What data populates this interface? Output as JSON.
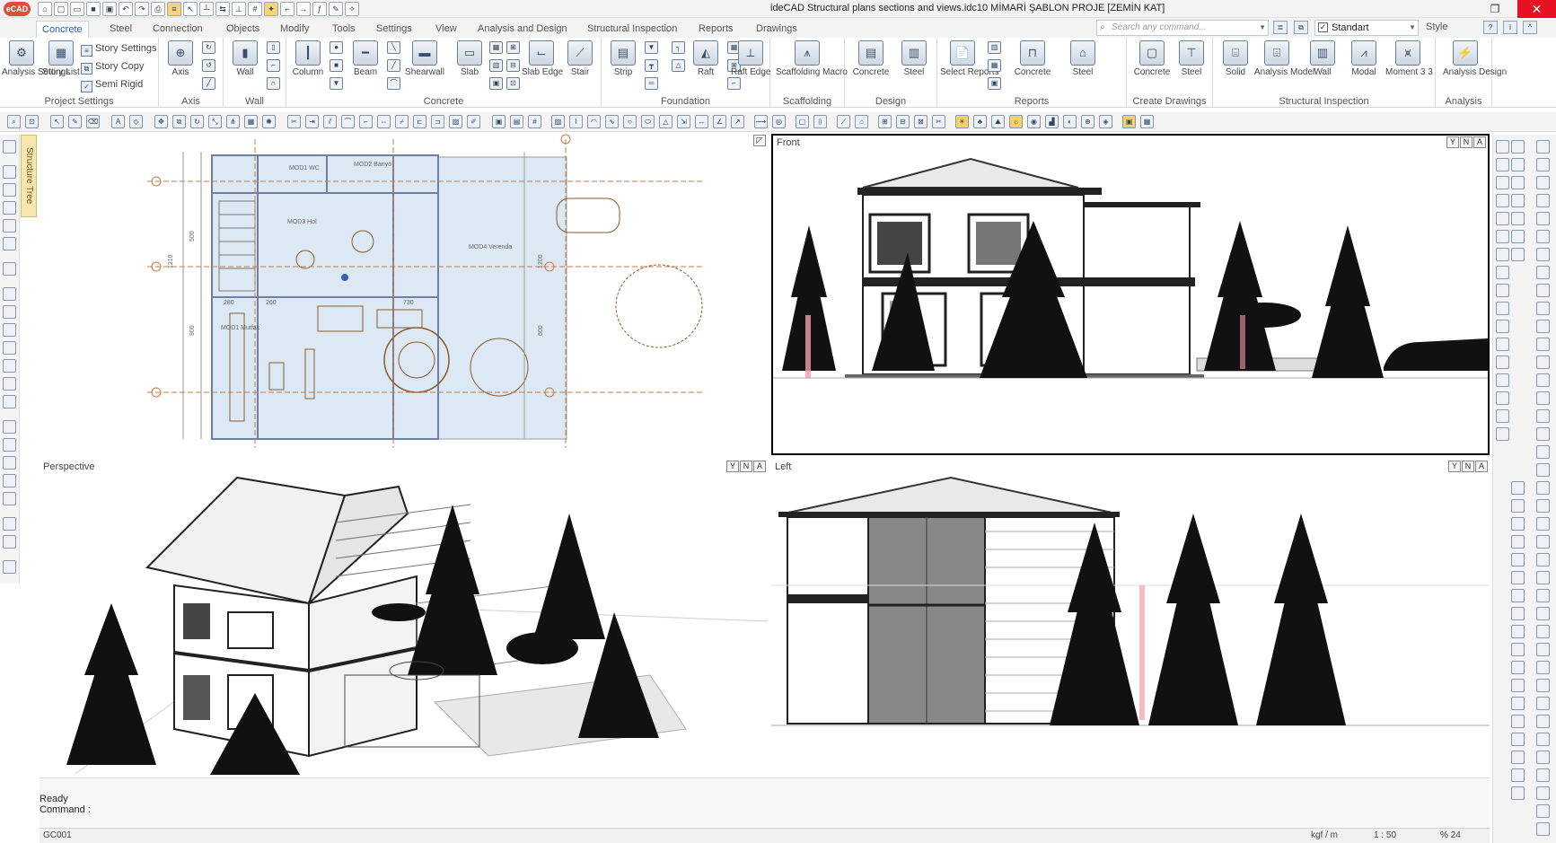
{
  "app": {
    "logo": "eCAD",
    "title": "ideCAD Structural   plans sections and views.idc10   MİMARİ ŞABLON PROJE   [ZEMİN KAT]"
  },
  "ribbon_tabs": [
    "Concrete",
    "Steel",
    "Connection",
    "Objects",
    "Modify",
    "Tools",
    "Settings",
    "View",
    "Analysis and Design",
    "Structural Inspection",
    "Reports",
    "Drawings"
  ],
  "search": {
    "placeholder": "Search any command..."
  },
  "style": {
    "value": "Standart",
    "label": "Style"
  },
  "groups": {
    "project_settings": {
      "label": "Project Settings",
      "analysis_settings": "Analysis Settings",
      "story_list": "Story List",
      "story_settings": "Story Settings",
      "story_copy": "Story Copy",
      "semi_rigid": "Semi Rigid"
    },
    "axis": {
      "label": "Axis",
      "btn": "Axis"
    },
    "wall": {
      "label": "Wall",
      "btn": "Wall"
    },
    "concrete": {
      "label": "Concrete",
      "column": "Column",
      "beam": "Beam",
      "shearwall": "Shearwall",
      "slab": "Slab",
      "slab_edge": "Slab Edge",
      "stair": "Stair"
    },
    "foundation": {
      "label": "Foundation",
      "strip": "Strip",
      "raft": "Raft",
      "raft_edge": "Raft Edge"
    },
    "scaffolding": {
      "label": "Scaffolding",
      "btn": "Scaffolding Macro"
    },
    "design": {
      "label": "Design",
      "concrete": "Concrete",
      "steel": "Steel"
    },
    "reports": {
      "label": "Reports",
      "select": "Select Reports",
      "concrete": "Concrete",
      "steel": "Steel"
    },
    "create_drawings": {
      "label": "Create Drawings",
      "concrete": "Concrete",
      "steel": "Steel"
    },
    "structural_inspection": {
      "label": "Structural Inspection",
      "solid": "Solid",
      "analysis_model": "Analysis Model",
      "wall": "Wall",
      "modal": "Modal",
      "moment": "Moment 3 3"
    },
    "analysis": {
      "label": "Analysis",
      "btn": "Analysis Design"
    }
  },
  "structure_tree": "Structure Tree",
  "viewports": {
    "plan": {
      "title": ""
    },
    "front": {
      "title": "Front",
      "ctrls": [
        "Y",
        "N",
        "A"
      ]
    },
    "perspective": {
      "title": "Perspective",
      "ctrls": [
        "Y",
        "N",
        "A"
      ]
    },
    "left": {
      "title": "Left",
      "ctrls": [
        "Y",
        "N",
        "A"
      ]
    }
  },
  "plan_labels": {
    "room_1": "MOD1\nWC",
    "room_2": "MOD2\nBanyo",
    "room_3": "MOD3\nHol",
    "room_4": "MOD4\nVerenda",
    "room_5": "MOD1\nMutfak",
    "dims": [
      "1210",
      "1200",
      "500",
      "280",
      "260",
      "730",
      "900",
      "600"
    ]
  },
  "command": {
    "status": "Ready",
    "prompt": "Command :"
  },
  "statusbar": {
    "layer": "GC001",
    "units": "kgf / m",
    "scale": "1 : 50",
    "zoom": "% 24"
  },
  "colors": {
    "accent": "#1f5fbf",
    "close": "#e81123",
    "highlight": "#f6d16a"
  }
}
